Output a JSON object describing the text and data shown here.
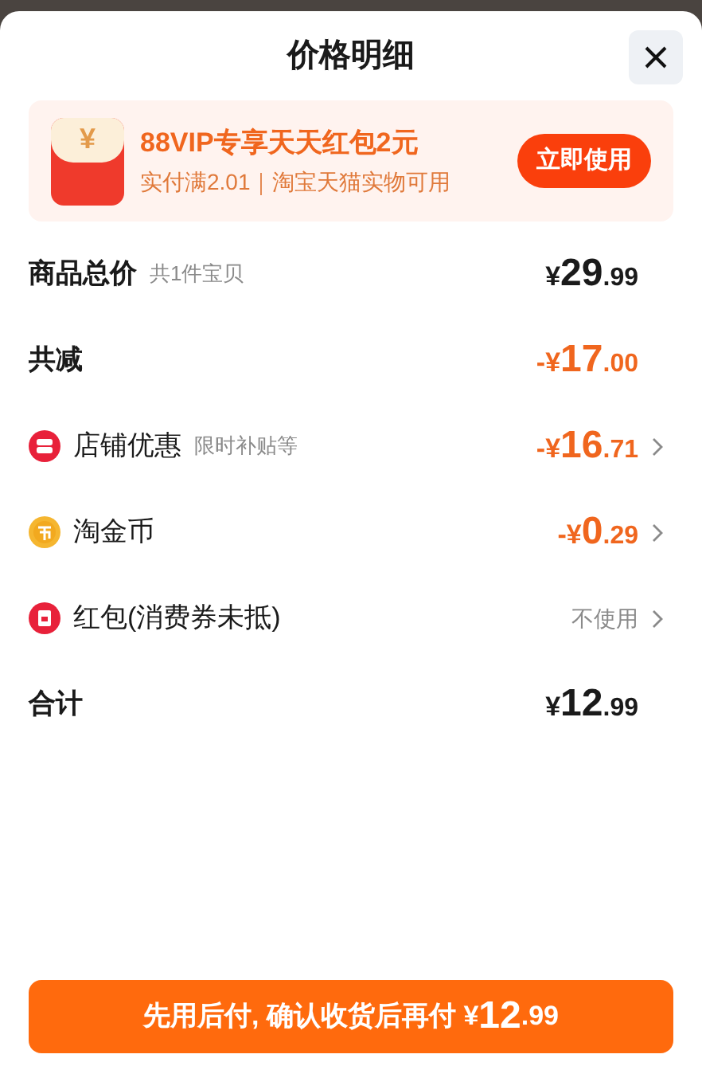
{
  "title": "价格明细",
  "promo": {
    "title": "88VIP专享天天红包2元",
    "subtitle": "实付满2.01｜淘宝天猫实物可用",
    "button": "立即使用",
    "icon_char": "¥"
  },
  "rows": [
    {
      "kind": "summary",
      "label": "商品总价",
      "note": "共1件宝贝",
      "value": {
        "color": "#1a1a1a",
        "prefix": "¥",
        "major": "29",
        "minor": ".99"
      },
      "chevron": false
    },
    {
      "kind": "summary",
      "label": "共减",
      "value": {
        "color": "#f0661e",
        "prefix": "-¥",
        "major": "17",
        "minor": ".00"
      },
      "chevron": false
    },
    {
      "kind": "shop",
      "label": "店铺优惠",
      "note": "限时补贴等",
      "value": {
        "color": "#f0661e",
        "prefix": "-¥",
        "major": "16",
        "minor": ".71"
      },
      "chevron": true
    },
    {
      "kind": "coin",
      "label": "淘金币",
      "value": {
        "color": "#f0661e",
        "prefix": "-¥",
        "major": "0",
        "minor": ".29"
      },
      "chevron": true
    },
    {
      "kind": "packet",
      "label": "红包(消费券未抵)",
      "text_value": "不使用",
      "chevron": true
    },
    {
      "kind": "summary",
      "label": "合计",
      "value": {
        "color": "#1a1a1a",
        "prefix": "¥",
        "major": "12",
        "minor": ".99"
      },
      "chevron": false
    }
  ],
  "pay_button": {
    "label": "先用后付, 确认收货后再付",
    "prefix": "¥",
    "major": "12",
    "minor": ".99"
  }
}
